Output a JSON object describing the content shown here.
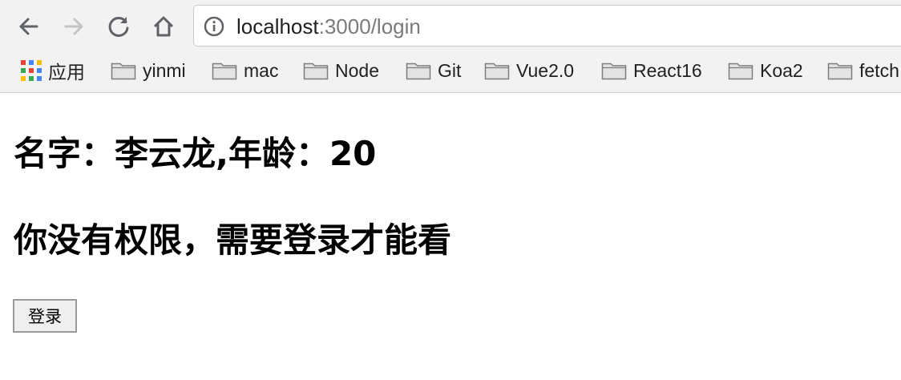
{
  "browser": {
    "back_icon": "arrow-left-icon",
    "forward_icon": "arrow-right-icon",
    "reload_icon": "reload-icon",
    "home_icon": "home-icon",
    "address": {
      "host": "localhost",
      "path": ":3000/login",
      "security_icon": "info-icon"
    },
    "bookmarks": [
      {
        "label": "应用",
        "icon": "apps-grid-icon"
      },
      {
        "label": "yinmi",
        "icon": "folder-icon"
      },
      {
        "label": "mac",
        "icon": "folder-icon"
      },
      {
        "label": "Node",
        "icon": "folder-icon"
      },
      {
        "label": "Git",
        "icon": "folder-icon"
      },
      {
        "label": "Vue2.0",
        "icon": "folder-icon"
      },
      {
        "label": "React16",
        "icon": "folder-icon"
      },
      {
        "label": "Koa2",
        "icon": "folder-icon"
      },
      {
        "label": "fetch",
        "icon": "folder-icon"
      }
    ]
  },
  "page": {
    "profile": "名字：李云龙,年龄：20",
    "permission_message": "你没有权限，需要登录才能看",
    "login_button": "登录"
  },
  "colors": {
    "chrome_bg": "#f2f2f2",
    "icon_gray": "#5f6368",
    "disabled_gray": "#c4c4c4",
    "url_path_gray": "#7a7a7a",
    "button_bg": "#efefef"
  }
}
